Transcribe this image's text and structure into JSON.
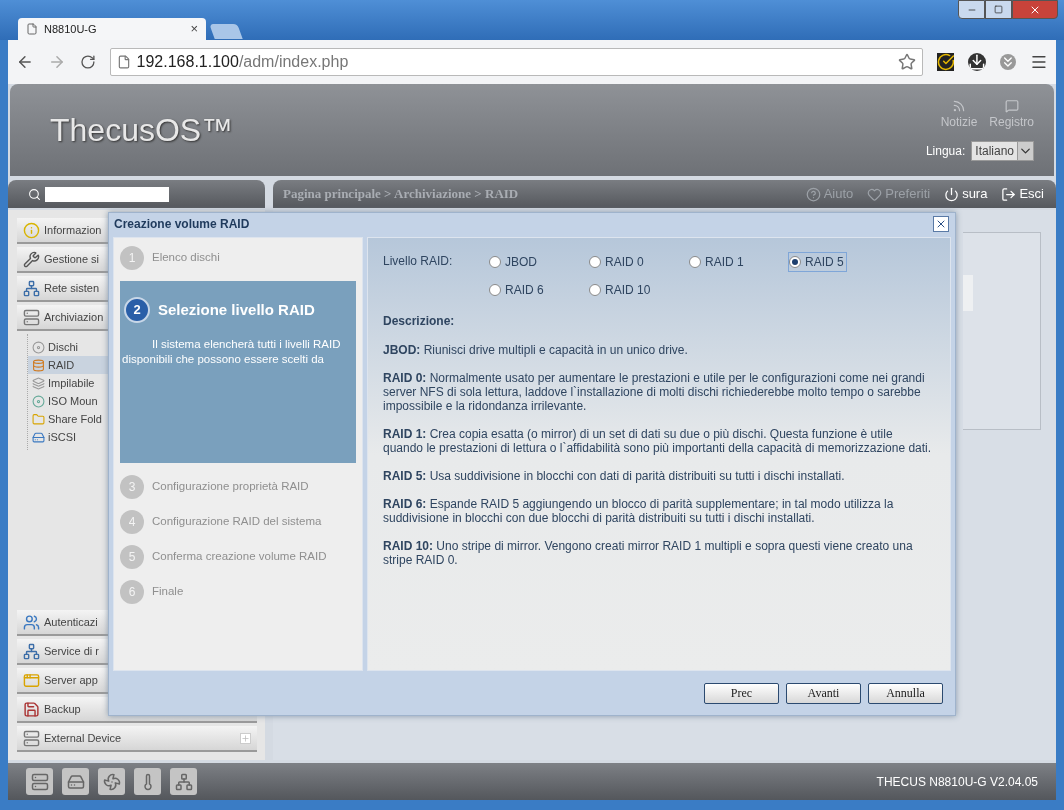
{
  "browser": {
    "tab_title": "N8810U-G",
    "tab_close": "×",
    "url_host": "192.168.1.100",
    "url_path": "/adm/index.php"
  },
  "header": {
    "logo": "ThecusOS™",
    "links": [
      {
        "label": "Notizie",
        "kind": "news"
      },
      {
        "label": "Registro",
        "kind": "log"
      }
    ],
    "language_label": "Lingua:",
    "language_value": "Italiano"
  },
  "toolbar": {
    "breadcrumb": "Pagina principale > Archiviazione > RAID",
    "actions": [
      {
        "label": "Aiuto",
        "kind": "help"
      },
      {
        "label": "Preferiti",
        "kind": "favorite"
      },
      {
        "label": "sura",
        "kind": "power"
      },
      {
        "label": "Esci",
        "kind": "exit"
      }
    ]
  },
  "sidebar": {
    "top_groups": [
      {
        "label": "Informazion",
        "kind": "info"
      },
      {
        "label": "Gestione si",
        "kind": "tools"
      },
      {
        "label": "Rete sisten",
        "kind": "network"
      },
      {
        "label": "Archiviazion",
        "kind": "storage",
        "expanded": true,
        "children": [
          {
            "label": "Dischi",
            "kind": "disk",
            "selected": false
          },
          {
            "label": "RAID",
            "kind": "raid",
            "selected": true
          },
          {
            "label": "Impilabile",
            "kind": "stack",
            "selected": false
          },
          {
            "label": "ISO Moun",
            "kind": "iso",
            "selected": false
          },
          {
            "label": "Share Fold",
            "kind": "folder",
            "selected": false
          },
          {
            "label": "iSCSI",
            "kind": "iscsi",
            "selected": false
          }
        ]
      }
    ],
    "bottom_groups": [
      {
        "label": "Autenticazi",
        "kind": "users"
      },
      {
        "label": "Service di r",
        "kind": "network"
      },
      {
        "label": "Server app",
        "kind": "apps"
      },
      {
        "label": "Backup",
        "kind": "backup"
      },
      {
        "label": "External Device",
        "kind": "storage",
        "expanded": false
      }
    ]
  },
  "dialog": {
    "title": "Creazione volume RAID",
    "steps": [
      {
        "number": "1",
        "label": "Elenco dischi",
        "selected": false
      },
      {
        "number": "2",
        "label": "Selezione livello RAID",
        "selected": true,
        "description": "Il sistema elencherà tutti i livelli RAID disponibili che possono essere scelti da"
      },
      {
        "number": "3",
        "label": "Configurazione proprietà RAID",
        "selected": false
      },
      {
        "number": "4",
        "label": "Configurazione RAID del sistema",
        "selected": false
      },
      {
        "number": "5",
        "label": "Conferma creazione volume RAID",
        "selected": false
      },
      {
        "number": "6",
        "label": "Finale",
        "selected": false
      }
    ],
    "level_label": "Livello RAID:",
    "options": [
      {
        "label": "JBOD",
        "selected": false
      },
      {
        "label": "RAID 0",
        "selected": false
      },
      {
        "label": "RAID 1",
        "selected": false
      },
      {
        "label": "RAID 5",
        "selected": true
      },
      {
        "label": "RAID 6",
        "selected": false
      },
      {
        "label": "RAID 10",
        "selected": false
      }
    ],
    "description_heading": "Descrizione:",
    "descriptions": [
      "**JBOD:** Riunisci drive multipli e capacità in un unico drive.",
      "**RAID 0:** Normalmente usato per aumentare le prestazioni e utile per le configurazioni come nei grandi server NFS di sola lettura, laddove l`installazione di molti dischi richiederebbe molto tempo o sarebbe impossibile e la ridondanza irrilevante.",
      "**RAID 1:** Crea copia esatta (o mirror) di un set di dati su due o più dischi. Questa funzione è utile quando le prestazioni di lettura o l`affidabilità sono più importanti della capacità di memorizzazione dati.",
      "**RAID 5:** Usa suddivisione in blocchi con dati di parità distribuiti su tutti i dischi installati.",
      "**RAID 6:** Espande RAID 5 aggiungendo un blocco di parità supplementare; in tal modo utilizza la suddivisione in blocchi con due blocchi di parità distribuiti su tutti i dischi installati.",
      "**RAID 10:** Uno stripe di mirror. Vengono creati mirror RAID 1 multipli e sopra questi viene creato una stripe RAID 0."
    ],
    "buttons": [
      "Prec",
      "Avanti",
      "Annulla"
    ]
  },
  "footer": {
    "status_icons": [
      {
        "kind": "server"
      },
      {
        "kind": "disk"
      },
      {
        "kind": "fan"
      },
      {
        "kind": "temperature"
      },
      {
        "kind": "network"
      }
    ],
    "version": "THECUS N8810U-G V2.04.05"
  }
}
